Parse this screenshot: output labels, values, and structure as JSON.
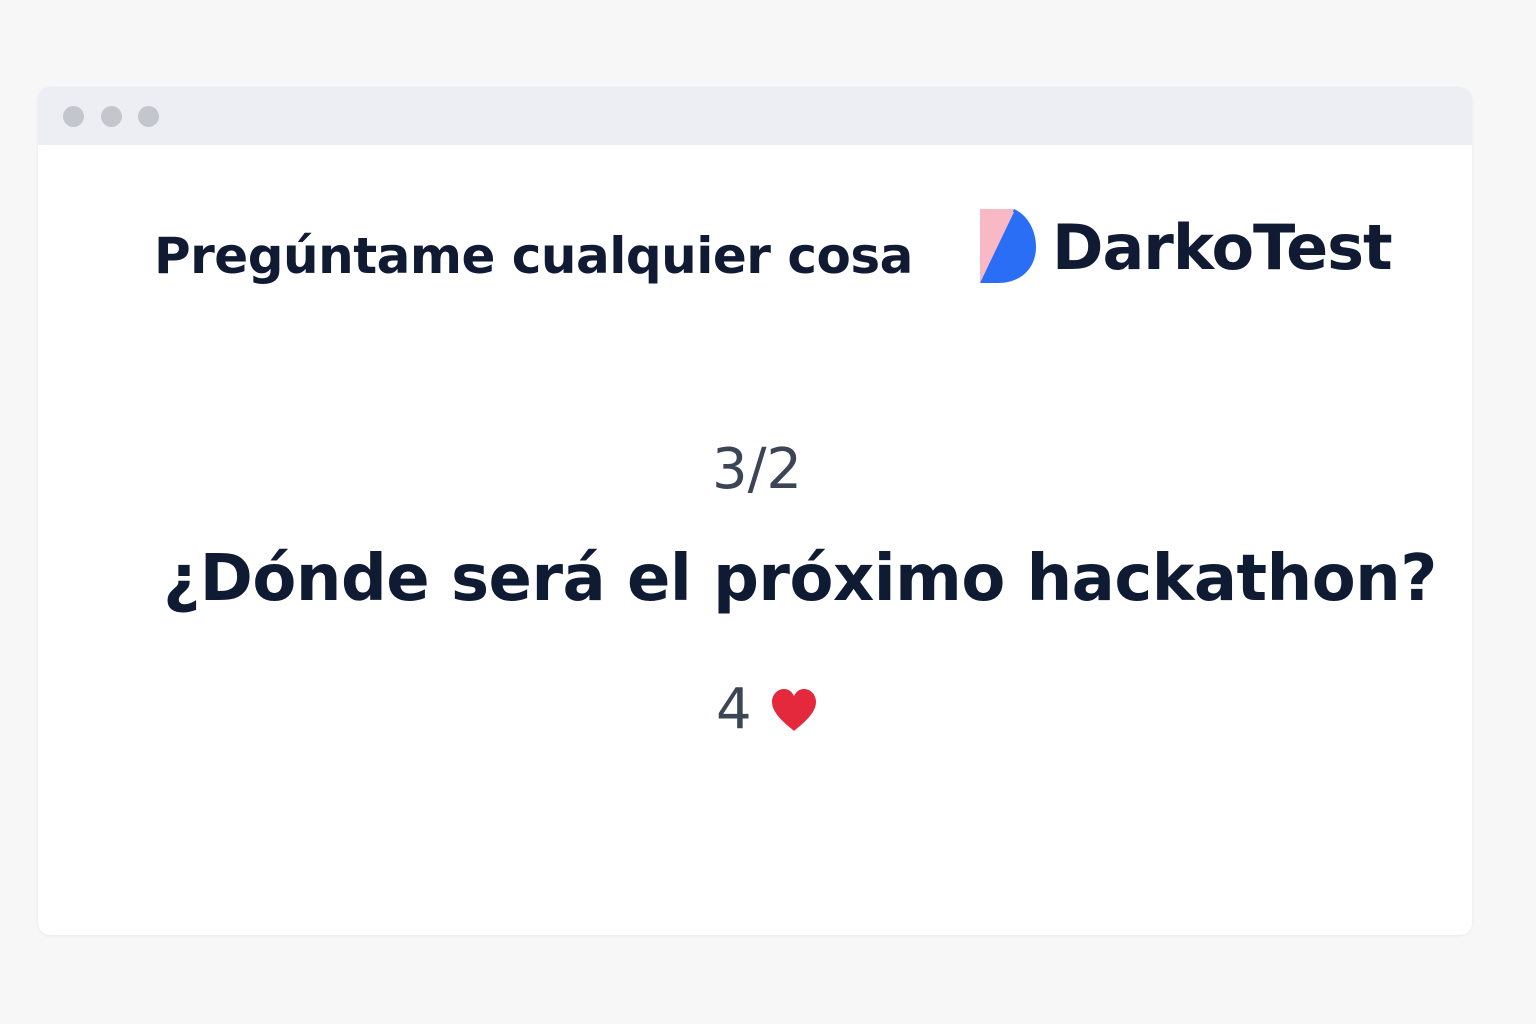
{
  "window": {
    "dots": [
      "close",
      "minimize",
      "maximize"
    ]
  },
  "session": {
    "title": "Pregúntame cualquier cosa"
  },
  "brand": {
    "name": "DarkoTest",
    "logo_icon": "darkotest-d-logo",
    "colors": {
      "pink": "#f9b8c6",
      "blue": "#2a6ef5"
    }
  },
  "question": {
    "counter": "3/2",
    "text": "¿Dónde será el próximo hackathon?",
    "likes": "4",
    "like_icon": "heart-icon",
    "like_color": "#e3293b"
  },
  "colors": {
    "text_dark": "#0f1a33",
    "text_muted": "#3c4556",
    "titlebar": "#edeef3"
  }
}
